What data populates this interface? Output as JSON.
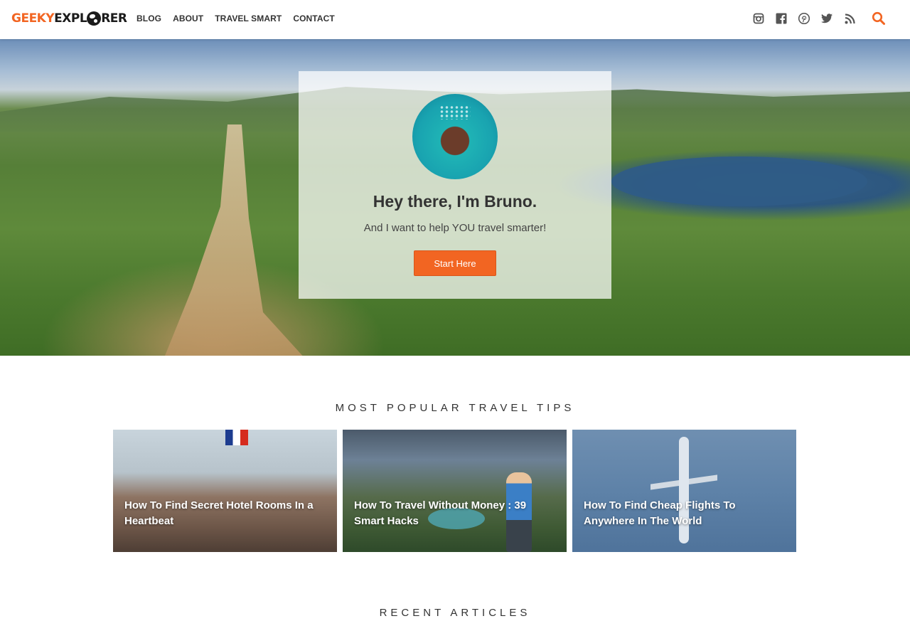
{
  "header": {
    "logo_part1": "GEEKY",
    "logo_part2": "EXPL",
    "logo_part3": "RER",
    "nav": [
      "BLOG",
      "ABOUT",
      "TRAVEL SMART",
      "CONTACT"
    ],
    "social_icons": [
      "instagram-icon",
      "facebook-icon",
      "pinterest-icon",
      "twitter-icon",
      "rss-icon"
    ],
    "search_icon": "search-icon"
  },
  "hero": {
    "greeting": "Hey there, I'm Bruno.",
    "subtitle": "And I want to help YOU travel smarter!",
    "cta_label": "Start Here"
  },
  "popular": {
    "title": "MOST POPULAR TRAVEL TIPS",
    "items": [
      {
        "title": "How To Find Secret Hotel Rooms In a Heartbeat"
      },
      {
        "title": "How To Travel Without Money : 39 Smart Hacks"
      },
      {
        "title": "How To Find Cheap Flights To Anywhere In The World"
      }
    ]
  },
  "recent": {
    "title": "RECENT ARTICLES"
  },
  "colors": {
    "accent": "#f26522",
    "text": "#333333"
  }
}
